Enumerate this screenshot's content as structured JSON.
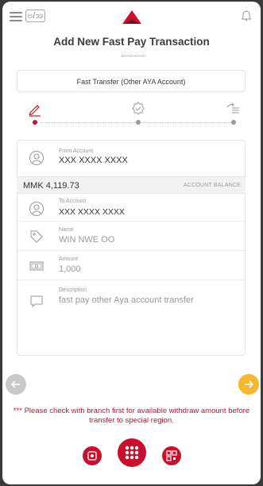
{
  "header": {
    "lang_label": "ဗ/အ",
    "title": "Add New Fast Pay Transaction"
  },
  "transfer_type": "Fast Transfer (Other AYA Account)",
  "steps": [
    "edit",
    "verify",
    "confirm"
  ],
  "from_account": {
    "label": "From Account",
    "value": "XXX XXXX XXXX"
  },
  "balance": {
    "amount": "MMK 4,119.73",
    "caption": "ACCOUNT BALANCE"
  },
  "to_account": {
    "label": "To Account",
    "value": "XXX XXXX XXXX"
  },
  "name": {
    "label": "Name",
    "value": "WIN NWE OO"
  },
  "amount": {
    "label": "Amount",
    "value": "1,000"
  },
  "description": {
    "label": "Description",
    "value": "fast pay other Aya account transfer"
  },
  "notice": "*** Please check with branch first for available withdraw amount before transfer to special region.",
  "colors": {
    "accent": "#c8102e",
    "next": "#f5b82e",
    "back": "#c9c9c9"
  }
}
